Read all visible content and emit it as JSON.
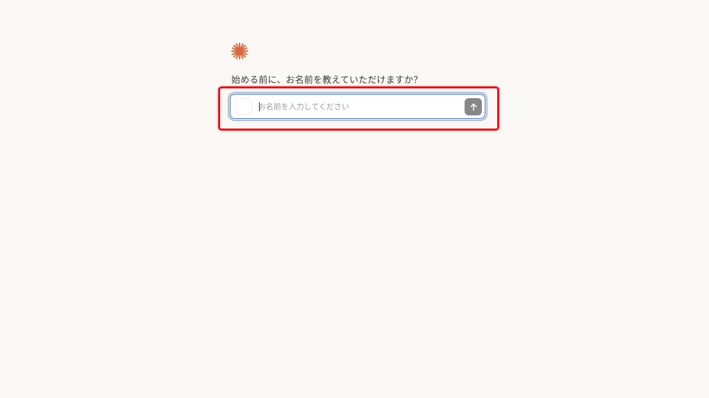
{
  "logo": {
    "icon": "sparkle-asterisk-icon",
    "color": "#d9683f"
  },
  "prompt": {
    "question": "始める前に、お名前を教えていただけますか？"
  },
  "name_input": {
    "value": "",
    "placeholder": "お名前を入力してください"
  },
  "send_button": {
    "icon": "arrow-up-icon",
    "color": "#878787"
  },
  "highlight": {
    "color": "#e8141c"
  }
}
